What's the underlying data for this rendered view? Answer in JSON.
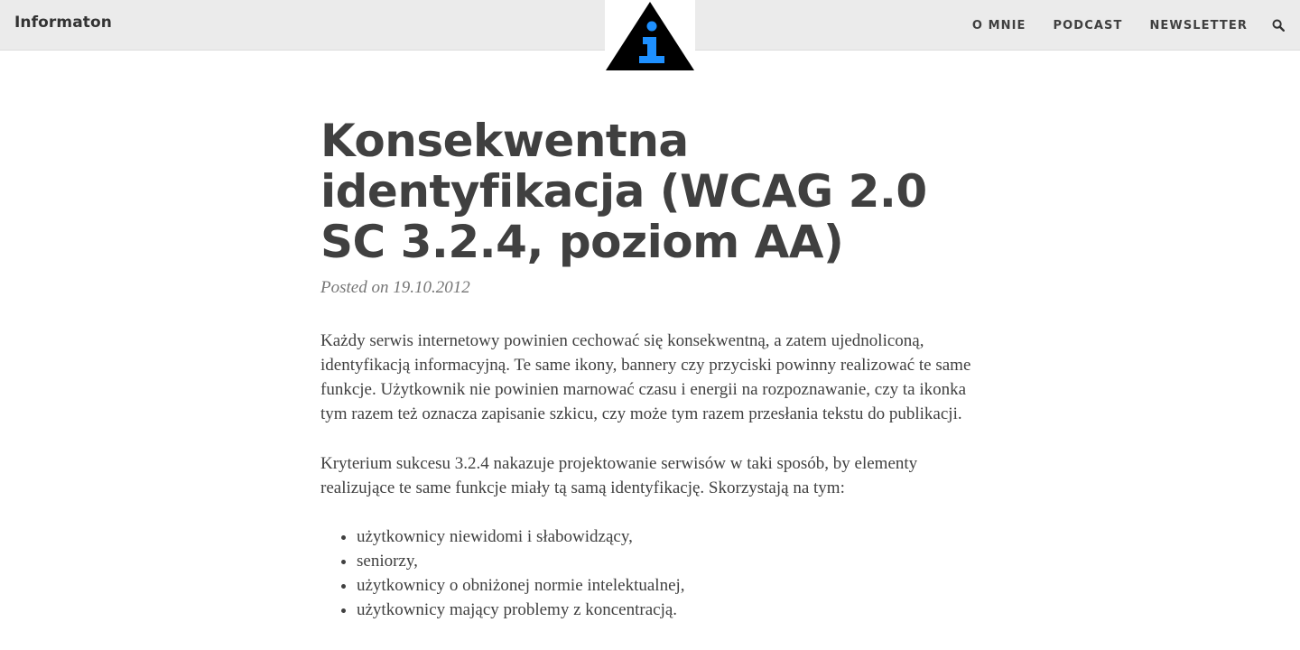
{
  "header": {
    "site_name": "Informaton",
    "nav": [
      {
        "label": "O MNIE"
      },
      {
        "label": "PODCAST"
      },
      {
        "label": "NEWSLETTER"
      }
    ],
    "search_icon": "search-icon",
    "logo_icon": "info-warning-triangle-logo",
    "colors": {
      "bar_bg": "#ebebeb",
      "logo_triangle": "#000000",
      "logo_i": "#1e90ff"
    }
  },
  "article": {
    "title": "Konsekwentna identyfikacja (WCAG 2.0 SC 3.2.4, poziom AA)",
    "meta": "Posted on 19.10.2012",
    "paragraphs": [
      "Każdy serwis internetowy powinien cechować się konsekwentną, a zatem ujednoliconą, identyfikacją informacyjną. Te same ikony, bannery czy przyciski powinny realizować te same funkcje. Użytkownik nie powinien marnować czasu i energii na rozpoznawanie, czy ta ikonka tym razem też oznacza zapisanie szkicu, czy może tym razem przesłania tekstu do publikacji.",
      "Kryterium sukcesu 3.2.4 nakazuje projektowanie serwisów w taki sposób, by elementy realizujące te same funkcje miały tą samą identyfikację. Skorzystają na tym:"
    ],
    "list": [
      "użytkownicy niewidomi i słabowidzący,",
      "seniorzy,",
      "użytkownicy o obniżonej normie intelektualnej,",
      "użytkownicy mający problemy z koncentracją."
    ]
  }
}
